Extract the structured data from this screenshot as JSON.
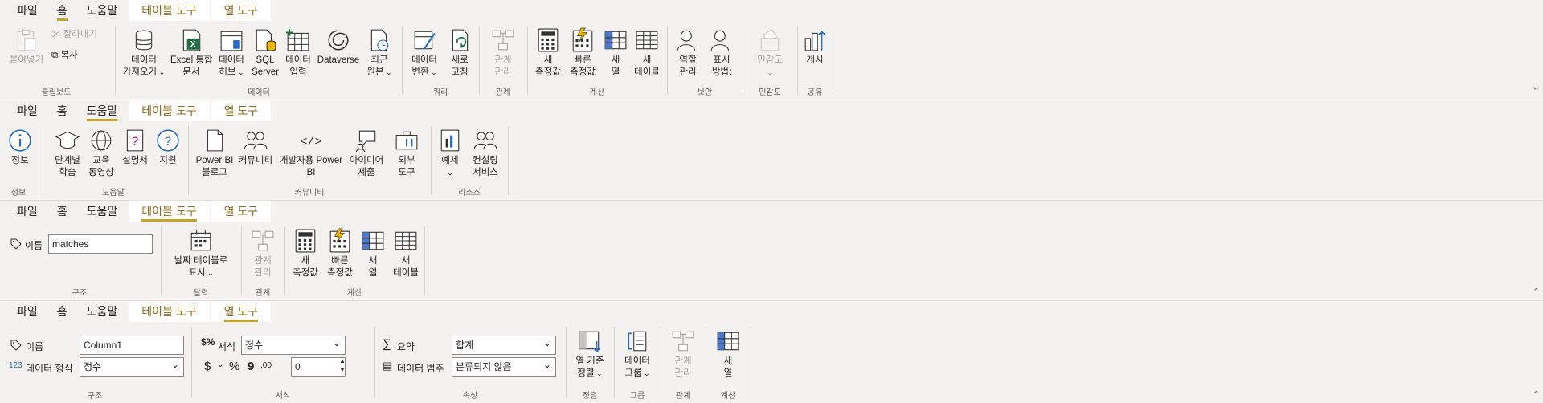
{
  "tabs": {
    "file": "파일",
    "home": "홈",
    "help": "도움말",
    "table_tools": "테이블 도구",
    "column_tools": "열 도구"
  },
  "ribbon1": {
    "clipboard": {
      "paste": "붙여넣기",
      "cut": "잘라내기",
      "copy": "복사",
      "label": "클립보드"
    },
    "data": {
      "get_data_1": "데이터",
      "get_data_2": "가져오기",
      "excel_1": "Excel 통합",
      "excel_2": "문서",
      "hub_1": "데이터",
      "hub_2": "허브",
      "sql_1": "SQL",
      "sql_2": "Server",
      "enter_1": "데이터",
      "enter_2": "입력",
      "dataverse": "Dataverse",
      "recent_1": "최근",
      "recent_2": "원본",
      "label": "데이터"
    },
    "query": {
      "transform_1": "데이터",
      "transform_2": "변환",
      "refresh_1": "새로",
      "refresh_2": "고침",
      "label": "쿼리"
    },
    "relations": {
      "manage_1": "관계",
      "manage_2": "관리",
      "label": "관계"
    },
    "calc": {
      "new_measure_1": "새",
      "new_measure_2": "측정값",
      "quick_1": "빠른",
      "quick_2": "측정값",
      "new_col_1": "새",
      "new_col_2": "열",
      "new_table_1": "새",
      "new_table_2": "테이블",
      "label": "계산"
    },
    "security": {
      "roles_1": "역할",
      "roles_2": "관리",
      "view_1": "표시",
      "view_2": "방법:",
      "label": "보안"
    },
    "sensitivity": {
      "btn": "민감도",
      "label": "민감도"
    },
    "share": {
      "publish": "게시",
      "label": "공유"
    }
  },
  "ribbon2": {
    "info": {
      "info": "정보",
      "label": "정보"
    },
    "help": {
      "guided_1": "단계별",
      "guided_2": "학습",
      "training_1": "교육",
      "training_2": "동영상",
      "docs": "설명서",
      "support": "지원",
      "label": "도움말"
    },
    "community": {
      "blog_1": "Power BI",
      "blog_2": "블로그",
      "community": "커뮤니티",
      "dev_1": "개발자용 Power",
      "dev_2": "BI",
      "ideas_1": "아이디어",
      "ideas_2": "제출",
      "ext_1": "외부",
      "ext_2": "도구",
      "label": "커뮤니티"
    },
    "resources": {
      "samples": "예제",
      "consult_1": "컨설팅",
      "consult_2": "서비스",
      "label": "리소스"
    }
  },
  "ribbon3": {
    "structure": {
      "name_label": "이름",
      "name_value": "matches",
      "label": "구조"
    },
    "calendars": {
      "mark_1": "날짜 테이블로",
      "mark_2": "표시",
      "label": "달력"
    },
    "relations": {
      "manage_1": "관계",
      "manage_2": "관리",
      "label": "관계"
    },
    "calc": {
      "new_measure_1": "새",
      "new_measure_2": "측정값",
      "quick_1": "빠른",
      "quick_2": "측정값",
      "new_col_1": "새",
      "new_col_2": "열",
      "new_table_1": "새",
      "new_table_2": "테이블",
      "label": "계산"
    }
  },
  "ribbon4": {
    "structure": {
      "name_label": "이름",
      "name_value": "Column1",
      "type_label": "데이터 형식",
      "type_value": "정수",
      "label": "구조"
    },
    "formatting": {
      "format_label": "서식",
      "format_value": "정수",
      "currency": "$",
      "percent": "%",
      "comma": "9",
      "decimals": ".00",
      "decimal_value": "0",
      "label": "서식"
    },
    "properties": {
      "summarize_label": "요약",
      "summarize_value": "합계",
      "category_label": "데이터 범주",
      "category_value": "분류되지 않음",
      "label": "속성"
    },
    "sort": {
      "sort_1": "열 기준",
      "sort_2": "정렬",
      "label": "정렬"
    },
    "groups": {
      "group_1": "데이터",
      "group_2": "그룹",
      "label": "그룹"
    },
    "relations": {
      "manage_1": "관계",
      "manage_2": "관리",
      "label": "관계"
    },
    "calc": {
      "new_col_1": "새",
      "new_col_2": "열",
      "label": "계산"
    }
  },
  "collapse_glyph": "⌃",
  "colors": {
    "accent": "#c8a528",
    "context_tab_text": "#8c6d17",
    "ribbon_bg": "#f3f2f1"
  }
}
